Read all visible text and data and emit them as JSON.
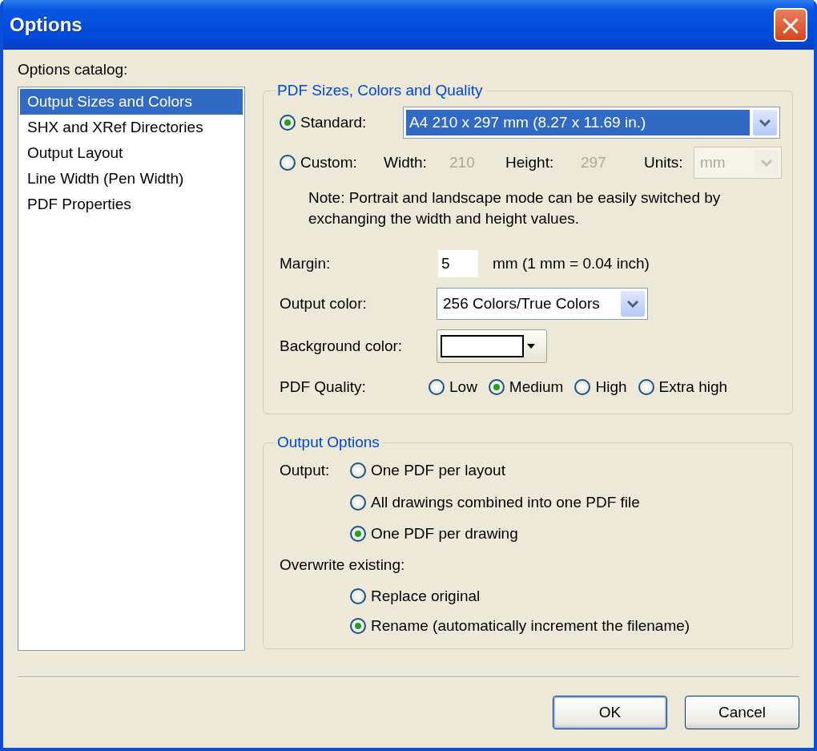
{
  "window": {
    "title": "Options",
    "close_button": "×"
  },
  "catalog": {
    "label": "Options catalog:",
    "items": [
      {
        "label": "Output Sizes and Colors",
        "selected": true
      },
      {
        "label": "SHX and XRef Directories",
        "selected": false
      },
      {
        "label": "Output Layout",
        "selected": false
      },
      {
        "label": "Line Width (Pen Width)",
        "selected": false
      },
      {
        "label": "PDF Properties",
        "selected": false
      }
    ]
  },
  "size_group": {
    "title": "PDF Sizes, Colors and Quality",
    "standard": {
      "label": "Standard:",
      "selected": true,
      "value": "A4 210 x 297 mm (8.27 x 11.69 in.)"
    },
    "custom": {
      "label": "Custom:",
      "selected": false,
      "disabled": true,
      "width_label": "Width:",
      "width_value": "210",
      "height_label": "Height:",
      "height_value": "297",
      "units_label": "Units:",
      "units_value": "mm"
    },
    "note": "Note: Portrait and landscape mode can be easily switched by exchanging the width and height values.",
    "margin": {
      "label": "Margin:",
      "value": "5",
      "unit": "mm  (1 mm = 0.04 inch)"
    },
    "output_color": {
      "label": "Output color:",
      "value": "256 Colors/True Colors"
    },
    "background_color": {
      "label": "Background color:"
    },
    "quality": {
      "label": "PDF Quality:",
      "options": [
        {
          "label": "Low",
          "selected": false
        },
        {
          "label": "Medium",
          "selected": true
        },
        {
          "label": "High",
          "selected": false
        },
        {
          "label": "Extra high",
          "selected": false
        }
      ]
    }
  },
  "output_group": {
    "title": "Output Options",
    "output_label": "Output:",
    "output_options": [
      {
        "label": "One PDF per layout",
        "selected": false
      },
      {
        "label": "All drawings combined into one PDF file",
        "selected": false
      },
      {
        "label": "One PDF per drawing",
        "selected": true
      }
    ],
    "overwrite_label": "Overwrite existing:",
    "overwrite_options": [
      {
        "label": "Replace original",
        "selected": false
      },
      {
        "label": "Rename (automatically increment the filename)",
        "selected": true
      }
    ]
  },
  "buttons": [
    {
      "label": "OK",
      "kind": "default"
    },
    {
      "label": "Cancel",
      "kind": "normal"
    }
  ]
}
